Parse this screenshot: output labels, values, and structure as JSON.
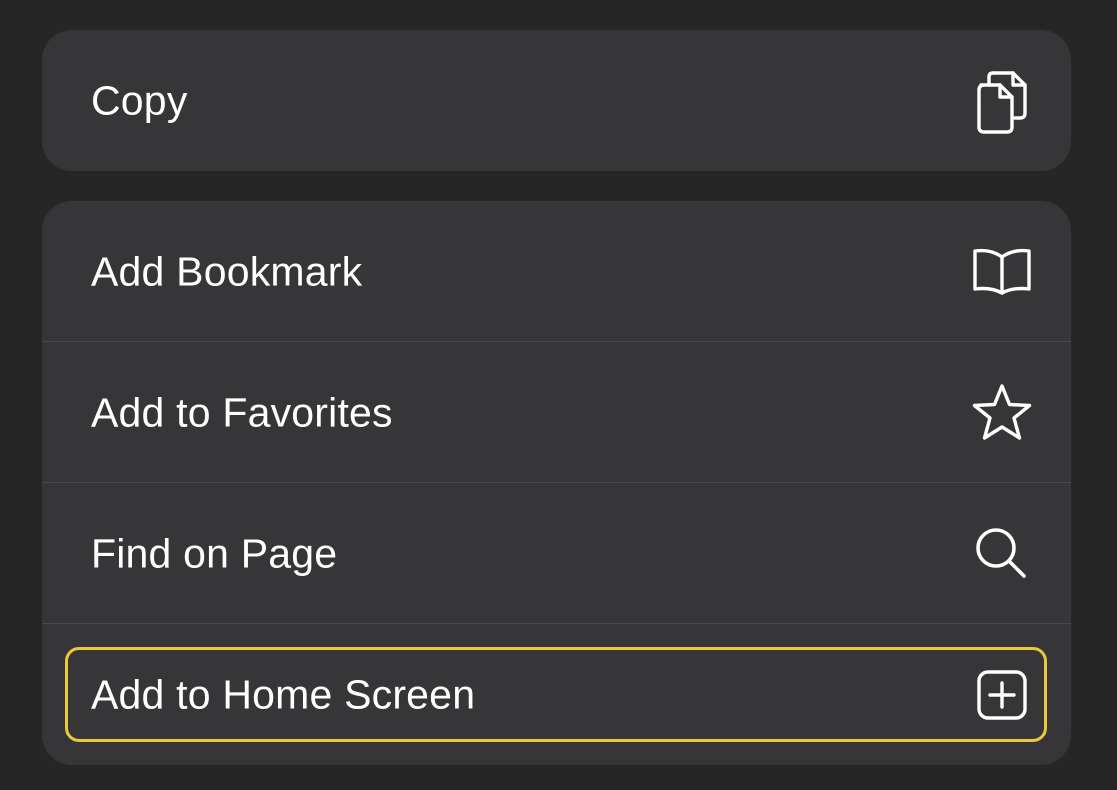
{
  "menu": {
    "group_1": {
      "items": [
        {
          "label": "Copy",
          "icon": "copy-icon"
        }
      ]
    },
    "group_2": {
      "items": [
        {
          "label": "Add Bookmark",
          "icon": "book-icon"
        },
        {
          "label": "Add to Favorites",
          "icon": "star-icon"
        },
        {
          "label": "Find on Page",
          "icon": "search-icon"
        },
        {
          "label": "Add to Home Screen",
          "icon": "plus-square-icon",
          "focused": true
        }
      ]
    }
  },
  "colors": {
    "background": "#262626",
    "group_background": "#363638",
    "text": "#ffffff",
    "focus_ring": "#e8c93b",
    "divider": "#4a4a4d"
  }
}
